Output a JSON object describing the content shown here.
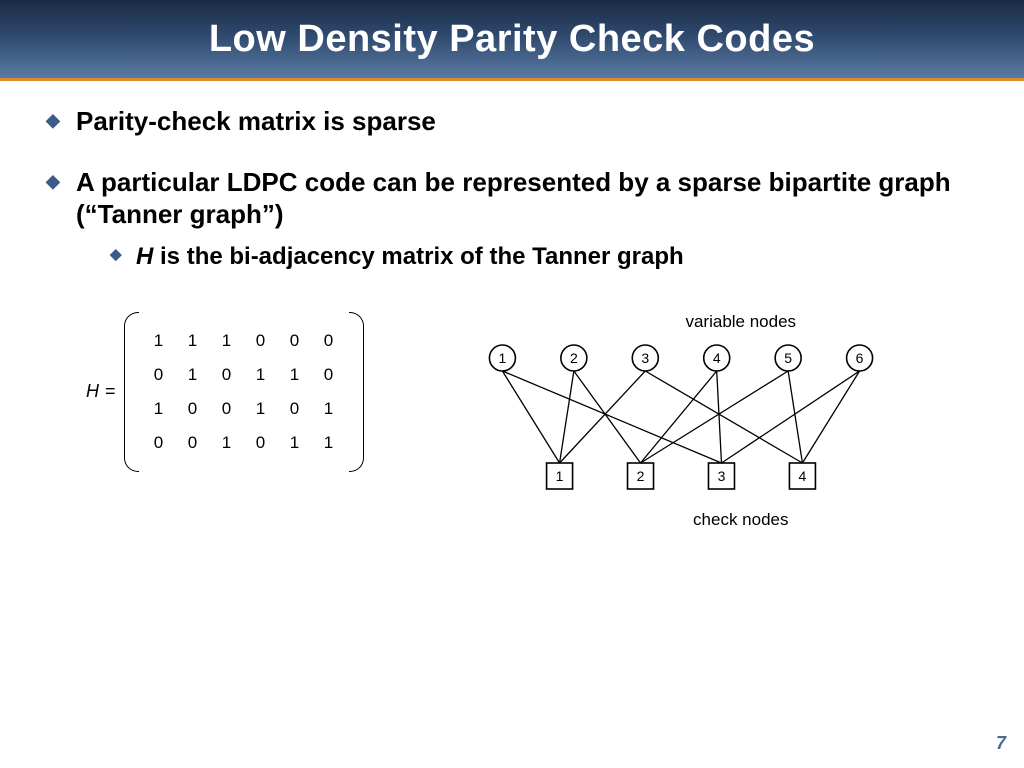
{
  "title": "Low Density Parity Check Codes",
  "bullets": {
    "b1": "Parity-check matrix is sparse",
    "b2": "A particular LDPC code can be represented by a sparse bipartite graph (“Tanner graph”)",
    "b2_sub1_pre": "H",
    "b2_sub1_rest": " is the bi-adjacency matrix of the Tanner graph"
  },
  "matrix": {
    "label": "H",
    "eq": "=",
    "rows": [
      [
        "1",
        "1",
        "1",
        "0",
        "0",
        "0"
      ],
      [
        "0",
        "1",
        "0",
        "1",
        "1",
        "0"
      ],
      [
        "1",
        "0",
        "0",
        "1",
        "0",
        "1"
      ],
      [
        "0",
        "0",
        "1",
        "0",
        "1",
        "1"
      ]
    ]
  },
  "graph": {
    "top_label": "variable nodes",
    "bottom_label": "check nodes",
    "var_nodes": [
      "1",
      "2",
      "3",
      "4",
      "5",
      "6"
    ],
    "check_nodes": [
      "1",
      "2",
      "3",
      "4"
    ],
    "edges": [
      [
        1,
        1
      ],
      [
        2,
        1
      ],
      [
        3,
        1
      ],
      [
        2,
        2
      ],
      [
        4,
        2
      ],
      [
        5,
        2
      ],
      [
        1,
        3
      ],
      [
        4,
        3
      ],
      [
        6,
        3
      ],
      [
        3,
        4
      ],
      [
        5,
        4
      ],
      [
        6,
        4
      ]
    ]
  },
  "page_number": "7"
}
